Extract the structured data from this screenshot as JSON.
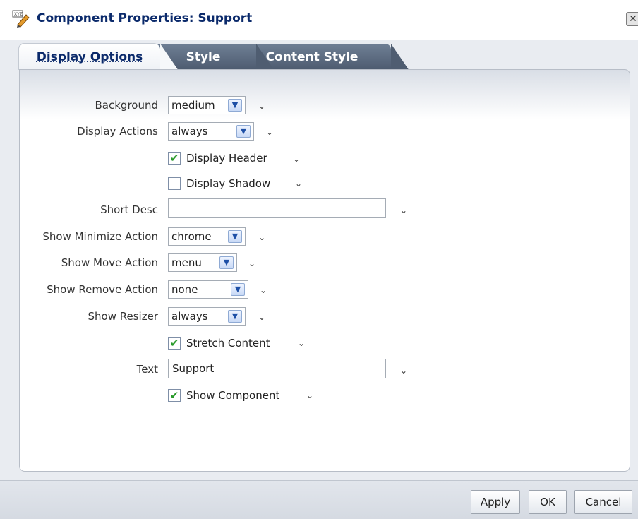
{
  "dialog": {
    "title": "Component Properties: Support",
    "close_icon": "close-icon",
    "title_icon": "component-edit-icon"
  },
  "tabs": [
    {
      "label": "Display Options",
      "active": true
    },
    {
      "label": "Style",
      "active": false
    },
    {
      "label": "Content Style",
      "active": false
    }
  ],
  "fields": {
    "background": {
      "label": "Background",
      "value": "medium"
    },
    "display_actions": {
      "label": "Display Actions",
      "value": "always"
    },
    "display_header": {
      "label": "Display Header",
      "checked": true
    },
    "display_shadow": {
      "label": "Display Shadow",
      "checked": false
    },
    "short_desc": {
      "label": "Short Desc",
      "value": ""
    },
    "show_minimize": {
      "label": "Show Minimize Action",
      "value": "chrome"
    },
    "show_move": {
      "label": "Show Move Action",
      "value": "menu"
    },
    "show_remove": {
      "label": "Show Remove Action",
      "value": "none"
    },
    "show_resizer": {
      "label": "Show Resizer",
      "value": "always"
    },
    "stretch_content": {
      "label": "Stretch Content",
      "checked": true
    },
    "text": {
      "label": "Text",
      "value": "Support"
    },
    "show_component": {
      "label": "Show Component",
      "checked": true
    }
  },
  "buttons": {
    "apply": "Apply",
    "ok": "OK",
    "cancel": "Cancel"
  },
  "colors": {
    "title": "#0b2a6b",
    "tab_inactive": "#5a687c",
    "check_green": "#2a9a2a"
  }
}
